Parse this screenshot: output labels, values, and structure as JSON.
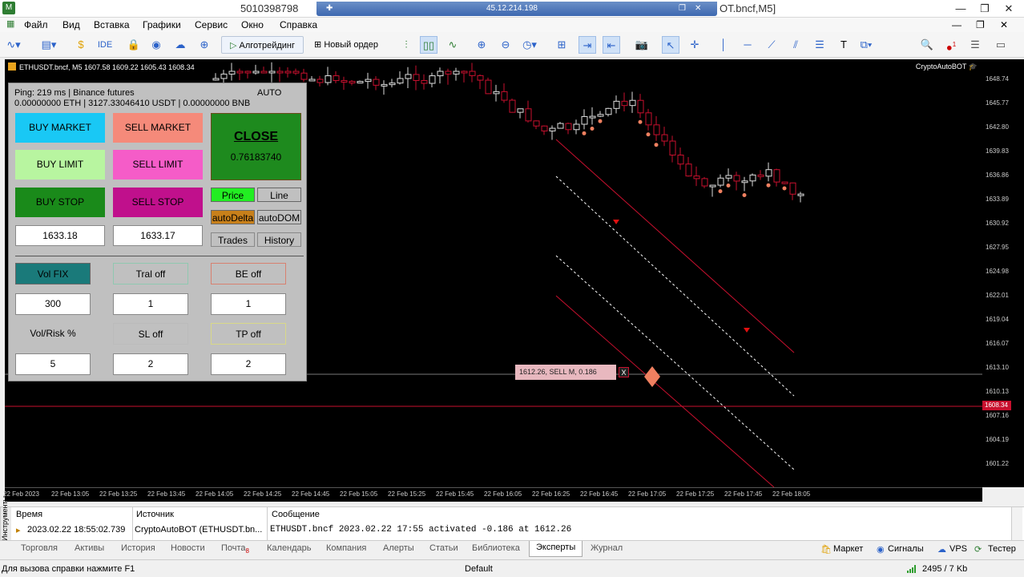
{
  "window": {
    "title": "5010398798",
    "remote_ip": "45.12.214.198",
    "title_suffix": "OT.bncf,M5]",
    "minimize": "—",
    "restore": "❐",
    "close": "✕"
  },
  "menu": [
    "Файл",
    "Вид",
    "Вставка",
    "Графики",
    "Сервис",
    "Окно",
    "Справка"
  ],
  "toolbar": {
    "ide": "IDE",
    "algo_trading": "Алготрейдинг",
    "new_order": "Новый ордер",
    "notifications_badge": "1"
  },
  "chart": {
    "symbol_header": "ETHUSDT.bncf, M5  1607.58 1609.22 1605.43 1608.34",
    "ea_name": "CryptoAutoBOT",
    "price_labels": [
      "1648.74",
      "1645.77",
      "1642.80",
      "1639.83",
      "1636.86",
      "1633.89",
      "1630.92",
      "1627.95",
      "1624.98",
      "1622.01",
      "1619.04",
      "1616.07",
      "1613.10",
      "1610.13",
      "1607.16",
      "1604.19",
      "1601.22"
    ],
    "current_price": "1608.34",
    "time_labels": [
      "22 Feb 2023",
      "22 Feb 13:05",
      "22 Feb 13:25",
      "22 Feb 13:45",
      "22 Feb 14:05",
      "22 Feb 14:25",
      "22 Feb 14:45",
      "22 Feb 15:05",
      "22 Feb 15:25",
      "22 Feb 15:45",
      "22 Feb 16:05",
      "22 Feb 16:25",
      "22 Feb 16:45",
      "22 Feb 17:05",
      "22 Feb 17:25",
      "22 Feb 17:45",
      "22 Feb 18:05"
    ],
    "trade_label": "1612.26, SELL M, 0.186",
    "trade_close": "X",
    "colors": {
      "bull": "#ffffff",
      "bear": "#c8102e",
      "channel": "#c8102e",
      "dashed": "#ffffff",
      "signal": "#f08060"
    }
  },
  "panel": {
    "status": "Ping: 219 ms | Binance futures",
    "balances": "0.00000000 ETH | 3127.33046410 USDT | 0.00000000 BNB",
    "mode": "AUTO",
    "buy_market": "BUY MARKET",
    "sell_market": "SELL MARKET",
    "buy_limit": "BUY LIMIT",
    "sell_limit": "SELL LIMIT",
    "buy_stop": "BUY STOP",
    "sell_stop": "SELL STOP",
    "close_label": "CLOSE",
    "close_value": "0.76183740",
    "buy_price": "1633.18",
    "sell_price": "1633.17",
    "price_btn": "Price",
    "line_btn": "Line",
    "auto_delta": "autoDelta",
    "auto_dom": "autoDOM",
    "trades": "Trades",
    "history": "History",
    "vol_fix": "Vol FIX",
    "tral_off": "Tral off",
    "be_off": "BE off",
    "vol_value": "300",
    "tral_value": "1",
    "be_value": "1",
    "vol_risk": "Vol/Risk %",
    "sl_off": "SL off",
    "tp_off": "TP off",
    "risk_value": "5",
    "sl_value": "2",
    "tp_value": "2"
  },
  "log": {
    "side_label": "Инструменты",
    "col_time": "Время",
    "col_source": "Источник",
    "col_message": "Сообщение",
    "row_time": "2023.02.22 18:55:02.739",
    "row_source": "CryptoAutoBOT (ETHUSDT.bn...",
    "row_message": "ETHUSDT.bncf 2023.02.22 17:55 activated -0.186 at 1612.26"
  },
  "tabs": [
    "Торговля",
    "Активы",
    "История",
    "Новости",
    "Почта",
    "Календарь",
    "Компания",
    "Алерты",
    "Статьи",
    "Библиотека",
    "Эксперты",
    "Журнал"
  ],
  "mail_badge": "8",
  "right_tabs": [
    "Маркет",
    "Сигналы",
    "VPS",
    "Тестер"
  ],
  "status": {
    "help": "Для вызова справки нажмите F1",
    "profile": "Default",
    "traffic": "2495 / 7 Kb"
  }
}
